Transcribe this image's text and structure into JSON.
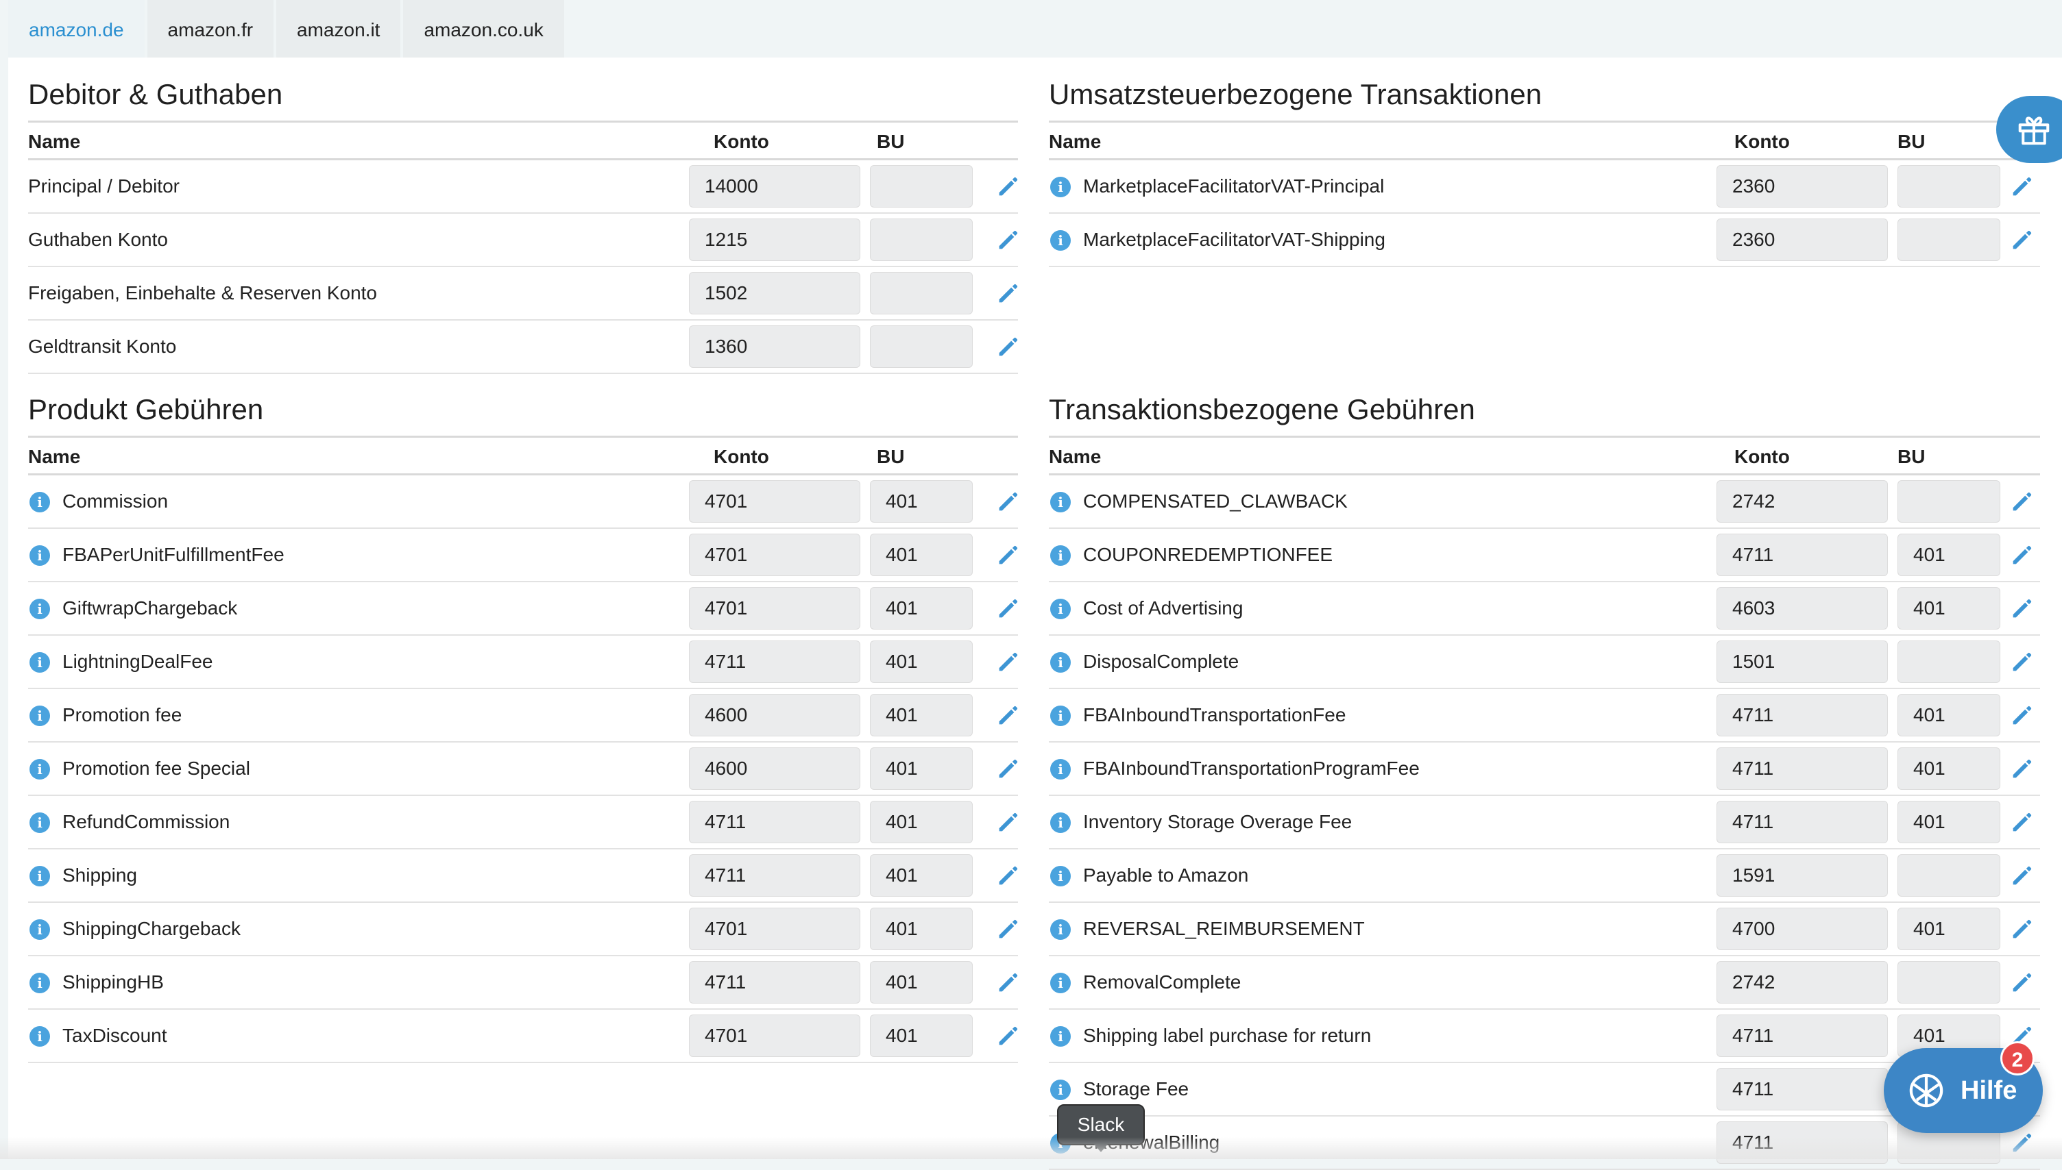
{
  "tabs": [
    {
      "label": "amazon.de",
      "active": true
    },
    {
      "label": "amazon.fr",
      "active": false
    },
    {
      "label": "amazon.it",
      "active": false
    },
    {
      "label": "amazon.co.uk",
      "active": false
    }
  ],
  "columns": {
    "name": "Name",
    "konto": "Konto",
    "bu": "BU"
  },
  "sections": {
    "debitor": {
      "title": "Debitor & Guthaben",
      "rows": [
        {
          "name": "Principal / Debitor",
          "konto": "14000",
          "bu": ""
        },
        {
          "name": "Guthaben Konto",
          "konto": "1215",
          "bu": ""
        },
        {
          "name": "Freigaben, Einbehalte & Reserven Konto",
          "konto": "1502",
          "bu": ""
        },
        {
          "name": "Geldtransit Konto",
          "konto": "1360",
          "bu": ""
        }
      ]
    },
    "umsatzsteuer": {
      "title": "Umsatzsteuerbezogene Transaktionen",
      "rows": [
        {
          "name": "MarketplaceFacilitatorVAT-Principal",
          "konto": "2360",
          "bu": ""
        },
        {
          "name": "MarketplaceFacilitatorVAT-Shipping",
          "konto": "2360",
          "bu": ""
        }
      ]
    },
    "produkt": {
      "title": "Produkt Gebühren",
      "rows": [
        {
          "name": "Commission",
          "konto": "4701",
          "bu": "401"
        },
        {
          "name": "FBAPerUnitFulfillmentFee",
          "konto": "4701",
          "bu": "401"
        },
        {
          "name": "GiftwrapChargeback",
          "konto": "4701",
          "bu": "401"
        },
        {
          "name": "LightningDealFee",
          "konto": "4711",
          "bu": "401"
        },
        {
          "name": "Promotion fee",
          "konto": "4600",
          "bu": "401"
        },
        {
          "name": "Promotion fee Special",
          "konto": "4600",
          "bu": "401"
        },
        {
          "name": "RefundCommission",
          "konto": "4711",
          "bu": "401"
        },
        {
          "name": "Shipping",
          "konto": "4711",
          "bu": "401"
        },
        {
          "name": "ShippingChargeback",
          "konto": "4701",
          "bu": "401"
        },
        {
          "name": "ShippingHB",
          "konto": "4711",
          "bu": "401"
        },
        {
          "name": "TaxDiscount",
          "konto": "4701",
          "bu": "401"
        }
      ]
    },
    "transaktion": {
      "title": "Transaktionsbezogene Gebühren",
      "rows": [
        {
          "name": "COMPENSATED_CLAWBACK",
          "konto": "2742",
          "bu": ""
        },
        {
          "name": "COUPONREDEMPTIONFEE",
          "konto": "4711",
          "bu": "401"
        },
        {
          "name": "Cost of Advertising",
          "konto": "4603",
          "bu": "401"
        },
        {
          "name": "DisposalComplete",
          "konto": "1501",
          "bu": ""
        },
        {
          "name": "FBAInboundTransportationFee",
          "konto": "4711",
          "bu": "401"
        },
        {
          "name": "FBAInboundTransportationProgramFee",
          "konto": "4711",
          "bu": "401"
        },
        {
          "name": "Inventory Storage Overage Fee",
          "konto": "4711",
          "bu": "401"
        },
        {
          "name": "Payable to Amazon",
          "konto": "1591",
          "bu": ""
        },
        {
          "name": "REVERSAL_REIMBURSEMENT",
          "konto": "4700",
          "bu": "401"
        },
        {
          "name": "RemovalComplete",
          "konto": "2742",
          "bu": ""
        },
        {
          "name": "Shipping label purchase for return",
          "konto": "4711",
          "bu": "401"
        },
        {
          "name": "Storage Fee",
          "konto": "4711",
          "bu": ""
        },
        {
          "name": "eRenewalBilling",
          "konto": "4711",
          "bu": ""
        }
      ]
    }
  },
  "help_widget": {
    "label": "Hilfe",
    "badge": "2"
  },
  "tooltip": {
    "text": "Slack"
  },
  "colors": {
    "accent": "#2a8fd0",
    "info": "#4aa3de",
    "help": "#3d86c6",
    "badge": "#e84a4a"
  },
  "icons": {
    "edit": "pencil-icon",
    "info": "info-icon",
    "gift": "gift-icon",
    "help": "help-globe-icon"
  }
}
